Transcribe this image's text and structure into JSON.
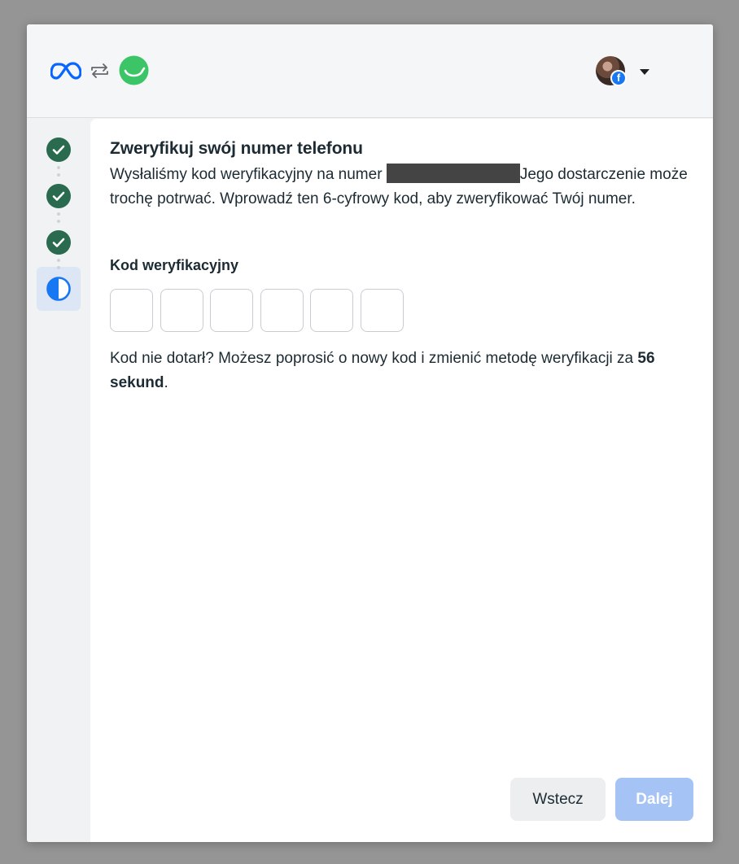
{
  "header": {
    "meta_logo_icon": "meta-logo",
    "swap_icon": "arrows-swap-icon",
    "app_logo_icon": "app-logo",
    "profile_badge": "f",
    "colors": {
      "meta_blue": "#0866ff",
      "app_green": "#3cc566",
      "facebook_blue": "#1877f2"
    }
  },
  "steps": [
    {
      "state": "completed",
      "icon": "check-icon"
    },
    {
      "state": "completed",
      "icon": "check-icon"
    },
    {
      "state": "completed",
      "icon": "check-icon"
    },
    {
      "state": "in-progress",
      "icon": "half-circle-icon"
    }
  ],
  "main": {
    "title": "Zweryfikuj swój numer telefonu",
    "description_before": "Wysłaliśmy kod weryfikacyjny na numer ",
    "description_after": "Jego dostarczenie może trochę potrwać. Wprowadź ten 6-cyfrowy kod, aby zweryfikować Twój numer.",
    "code_label": "Kod weryfikacyjny",
    "code_digits": [
      "",
      "",
      "",
      "",
      "",
      ""
    ],
    "resend_text": "Kod nie dotarł? Możesz poprosić o nowy kod i zmienić metodę weryfikacji za ",
    "resend_countdown": "56 sekund",
    "resend_end": "."
  },
  "footer": {
    "back_label": "Wstecz",
    "next_label": "Dalej"
  }
}
